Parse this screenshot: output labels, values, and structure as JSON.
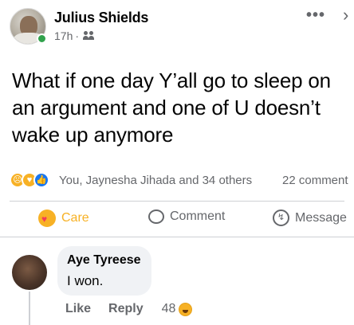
{
  "post": {
    "author": "Julius Shields",
    "time": "17h",
    "separator": "·",
    "more_icon": "more-horizontal-icon",
    "close_icon": "close-icon",
    "text": "What if one day Y’all go to sleep on an argument and one of U doesn’t wake up anymore"
  },
  "reactions": {
    "icons": [
      "sad-reaction-icon",
      "care-reaction-icon",
      "like-reaction-icon"
    ],
    "summary": "You, Jaynesha Jihada and 34 others",
    "comment_count": "22 comment"
  },
  "actions": {
    "care_label": "Care",
    "comment_label": "Comment",
    "message_label": "Message"
  },
  "comment": {
    "author": "Aye Tyreese",
    "text": "I won.",
    "like_label": "Like",
    "reply_label": "Reply",
    "reaction_count": "48"
  },
  "colors": {
    "care": "#f7b125",
    "like": "#1877f2",
    "secondary_text": "#65676b",
    "online": "#31a24c"
  }
}
